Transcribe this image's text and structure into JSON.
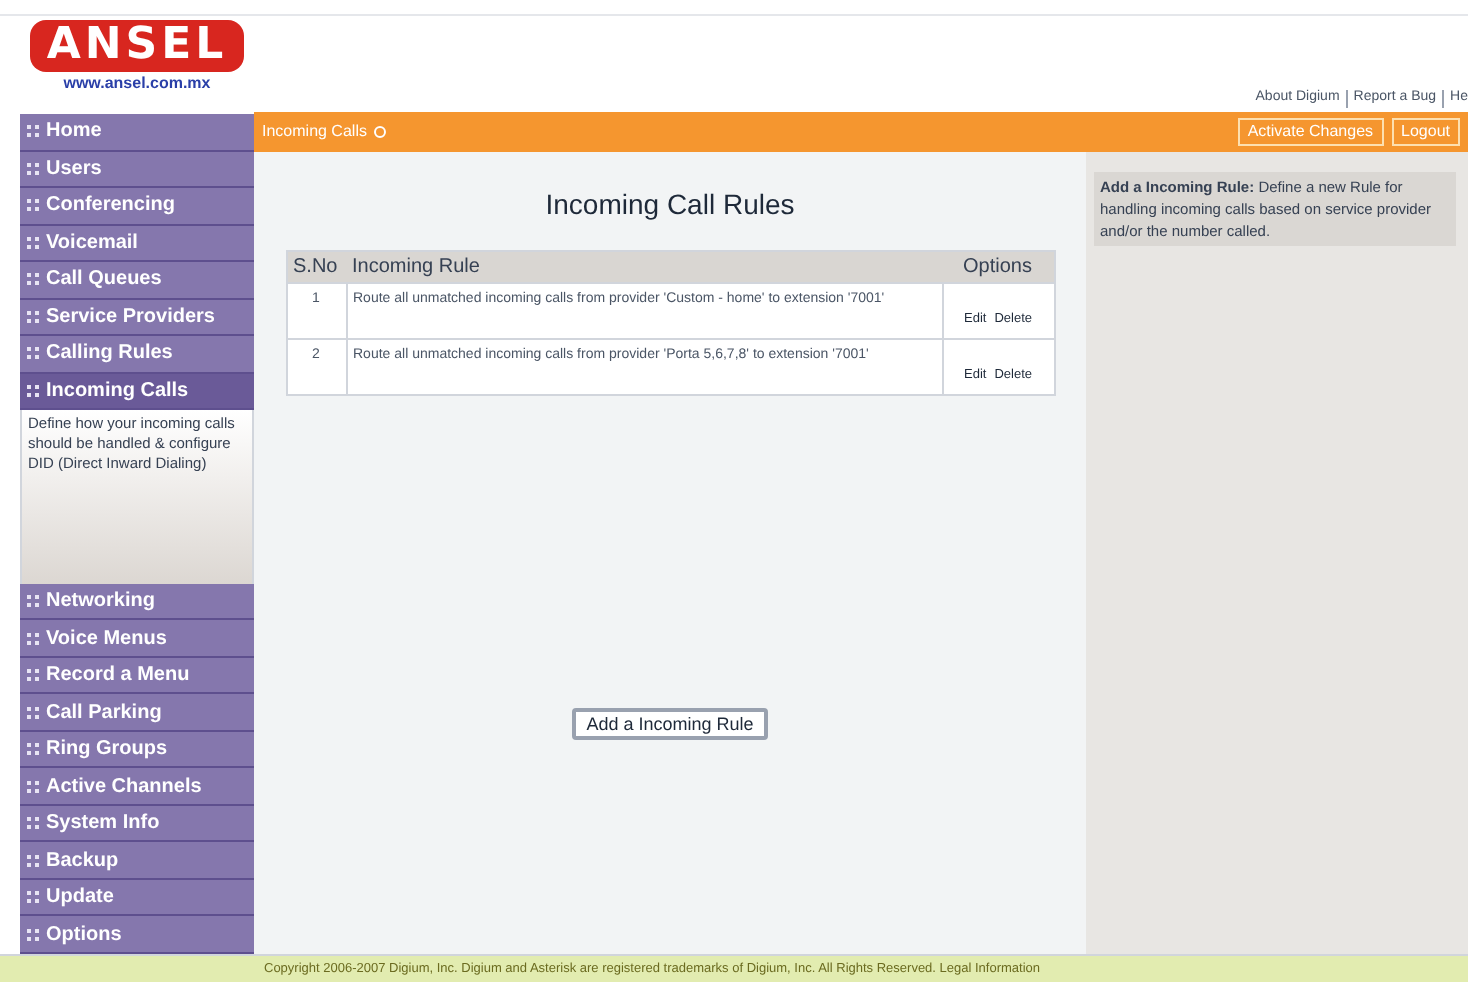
{
  "logo": {
    "name": "ANSEL",
    "url": "www.ansel.com.mx"
  },
  "top_links": [
    "About Digium",
    "Report a Bug",
    "He"
  ],
  "header_bar": {
    "title": "Incoming Calls",
    "buttons": [
      "Activate Changes",
      "Logout"
    ]
  },
  "sidebar": {
    "items": [
      {
        "label": "Home",
        "selected": false
      },
      {
        "label": "Users",
        "selected": false
      },
      {
        "label": "Conferencing",
        "selected": false
      },
      {
        "label": "Voicemail",
        "selected": false
      },
      {
        "label": "Call Queues",
        "selected": false
      },
      {
        "label": "Service Providers",
        "selected": false
      },
      {
        "label": "Calling Rules",
        "selected": false
      },
      {
        "label": "Incoming Calls",
        "selected": true,
        "description": "Define how your incoming calls should be handled & configure DID (Direct Inward Dialing)"
      },
      {
        "label": "Networking",
        "selected": false
      },
      {
        "label": "Voice Menus",
        "selected": false
      },
      {
        "label": "Record a Menu",
        "selected": false
      },
      {
        "label": "Call Parking",
        "selected": false
      },
      {
        "label": "Ring Groups",
        "selected": false
      },
      {
        "label": "Active Channels",
        "selected": false
      },
      {
        "label": "System Info",
        "selected": false
      },
      {
        "label": "Backup",
        "selected": false
      },
      {
        "label": "Update",
        "selected": false
      },
      {
        "label": "Options",
        "selected": false
      }
    ]
  },
  "main": {
    "title": "Incoming Call Rules",
    "table": {
      "columns": [
        "S.No",
        "Incoming Rule",
        "Options"
      ],
      "rows": [
        {
          "sno": "1",
          "rule": "Route all unmatched incoming calls from provider 'Custom - home' to extension '7001'",
          "actions": [
            "Edit",
            "Delete"
          ]
        },
        {
          "sno": "2",
          "rule": "Route all unmatched incoming calls from provider 'Porta 5,6,7,8' to extension '7001'",
          "actions": [
            "Edit",
            "Delete"
          ]
        }
      ]
    },
    "add_button": "Add a Incoming Rule"
  },
  "help_panel": {
    "title": "Add a Incoming Rule:",
    "text": "Define a new Rule for handling incoming calls based on service provider and/or the number called."
  },
  "footer": "Copyright 2006-2007 Digium, Inc. Digium and Asterisk are registered trademarks of Digium, Inc. All Rights Reserved. Legal Information"
}
